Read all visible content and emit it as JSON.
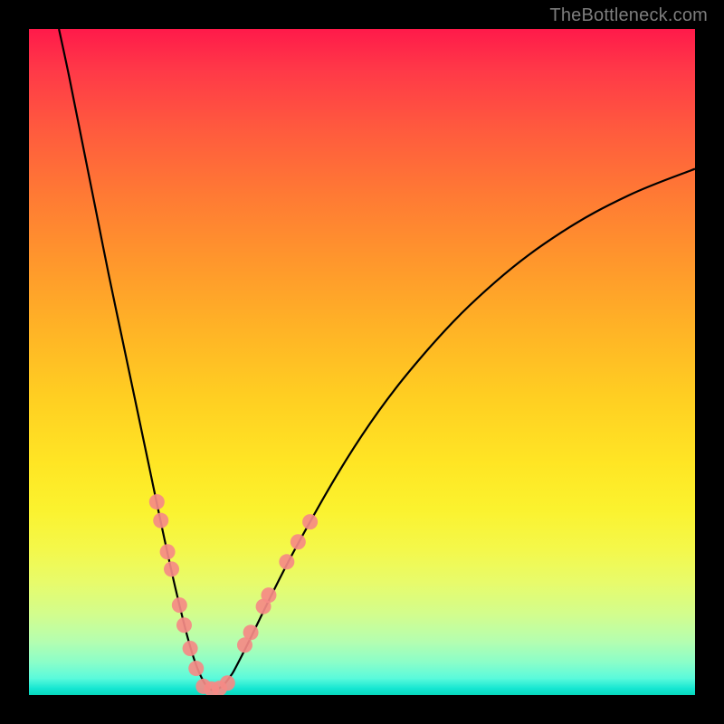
{
  "watermark": "TheBottleneck.com",
  "chart_data": {
    "type": "line",
    "title": "",
    "xlabel": "",
    "ylabel": "",
    "xlim": [
      0,
      100
    ],
    "ylim": [
      0,
      100
    ],
    "grid": false,
    "legend": false,
    "series": [
      {
        "name": "bottleneck-curve",
        "color": "#000000",
        "x": [
          4.5,
          6,
          8,
          10,
          12,
          14,
          16,
          18,
          20,
          22,
          24,
          25.5,
          27,
          28.5,
          30,
          32,
          40,
          50,
          60,
          70,
          80,
          90,
          100
        ],
        "y": [
          100,
          93,
          83,
          73,
          63,
          53.5,
          44,
          34.5,
          25,
          16,
          8,
          3.5,
          1,
          1,
          2.5,
          6,
          22,
          39,
          52,
          62,
          69.5,
          75,
          79
        ]
      }
    ],
    "markers": [
      {
        "name": "left-branch-dots",
        "color": "#f58a85",
        "points": [
          {
            "x": 19.2,
            "y": 29.0
          },
          {
            "x": 19.8,
            "y": 26.2
          },
          {
            "x": 20.8,
            "y": 21.5
          },
          {
            "x": 21.4,
            "y": 18.9
          },
          {
            "x": 22.6,
            "y": 13.5
          },
          {
            "x": 23.3,
            "y": 10.5
          },
          {
            "x": 24.2,
            "y": 7.0
          },
          {
            "x": 25.1,
            "y": 4.0
          }
        ]
      },
      {
        "name": "bottom-dots",
        "color": "#f58a85",
        "points": [
          {
            "x": 26.2,
            "y": 1.3
          },
          {
            "x": 27.4,
            "y": 0.9
          },
          {
            "x": 28.6,
            "y": 1.0
          },
          {
            "x": 29.8,
            "y": 1.8
          }
        ]
      },
      {
        "name": "right-branch-dots",
        "color": "#f58a85",
        "points": [
          {
            "x": 32.4,
            "y": 7.5
          },
          {
            "x": 33.3,
            "y": 9.4
          },
          {
            "x": 35.2,
            "y": 13.3
          },
          {
            "x": 36.0,
            "y": 15.0
          },
          {
            "x": 38.7,
            "y": 20.0
          },
          {
            "x": 40.4,
            "y": 23.0
          },
          {
            "x": 42.2,
            "y": 26.0
          }
        ]
      }
    ]
  }
}
